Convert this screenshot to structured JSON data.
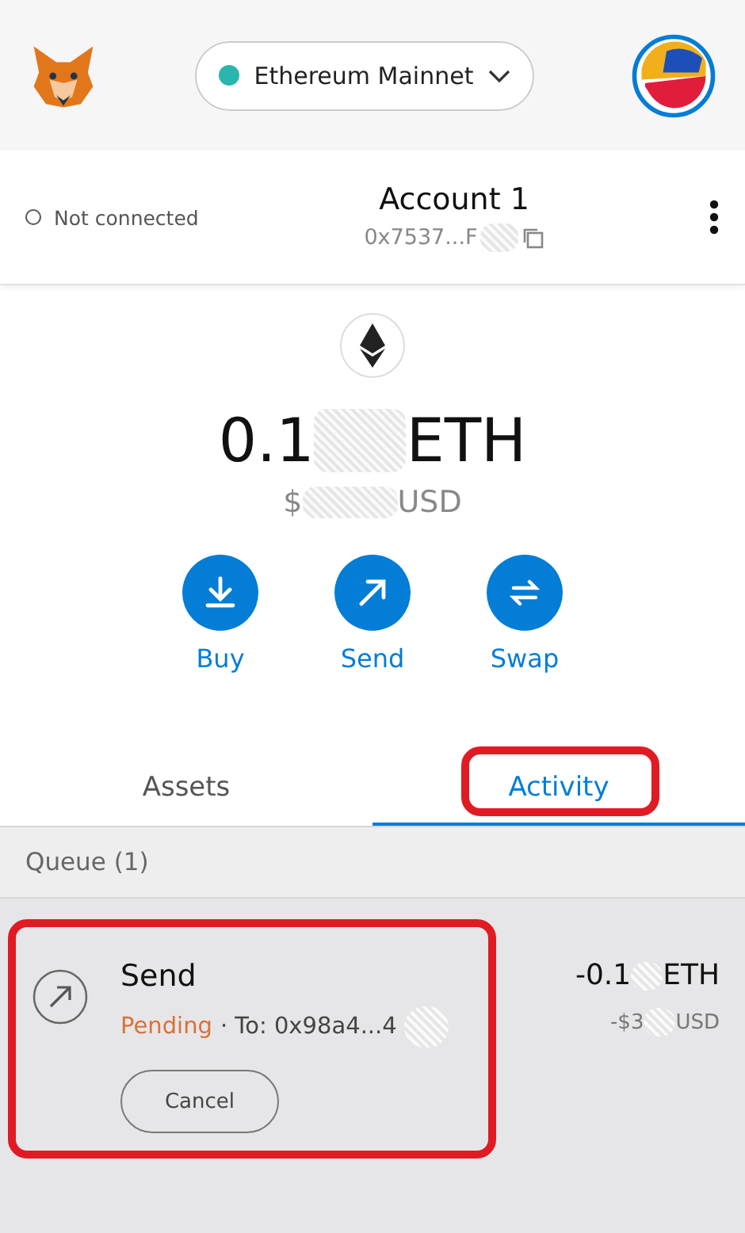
{
  "header": {
    "network": {
      "label": "Ethereum Mainnet",
      "color": "#29b6af"
    }
  },
  "account": {
    "connection": "Not connected",
    "name": "Account 1",
    "address": "0x7537...F"
  },
  "balance": {
    "amount": "0.1",
    "unit": "ETH",
    "fiat_prefix": "$",
    "fiat_unit": "USD"
  },
  "actions": [
    {
      "kind": "buy",
      "label": "Buy"
    },
    {
      "kind": "send",
      "label": "Send"
    },
    {
      "kind": "swap",
      "label": "Swap"
    }
  ],
  "tabs": [
    {
      "label": "Assets",
      "selected": false,
      "annotated": false
    },
    {
      "label": "Activity",
      "selected": true,
      "annotated": true
    }
  ],
  "queue": {
    "label": "Queue (1)"
  },
  "transactions": [
    {
      "title": "Send",
      "status": "Pending",
      "recipient": "· To: 0x98a4...4",
      "amount": "-0.1",
      "amount_unit": "ETH",
      "fiat": "-$3",
      "fiat_unit": "USD",
      "action": "Cancel",
      "annotated": true
    }
  ]
}
